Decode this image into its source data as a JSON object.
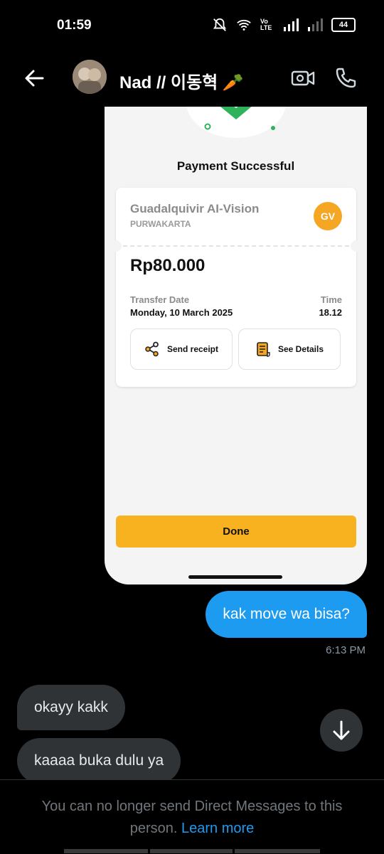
{
  "status_bar": {
    "time": "01:59",
    "network": "Vo LTE",
    "battery": "44"
  },
  "header": {
    "title": "Nad // 이동혁 🥕",
    "icons": [
      "back-arrow-icon",
      "video-camera-icon",
      "phone-icon"
    ]
  },
  "receipt": {
    "title": "Payment Successful",
    "merchant_name": "Guadalquivir AI-Vision",
    "merchant_location": "PURWAKARTA",
    "merchant_initials": "GV",
    "amount": "Rp80.000",
    "transfer_date_label": "Transfer Date",
    "transfer_date": "Monday, 10 March 2025",
    "time_label": "Time",
    "time": "18.12",
    "send_receipt_label": "Send receipt",
    "see_details_label": "See Details",
    "done_label": "Done",
    "accent_color": "#f9b21f"
  },
  "messages": {
    "outgoing": {
      "text": "kak move wa bisa?",
      "time": "6:13 PM"
    },
    "incoming": [
      {
        "text": "okayy kakk"
      },
      {
        "text": "kaaaa buka dulu ya"
      }
    ]
  },
  "footer": {
    "notice": "You can no longer send Direct Messages to this person.",
    "link": "Learn more"
  },
  "colors": {
    "bubble_out": "#1d9bf0",
    "bubble_in": "#2f3336",
    "link": "#1d9bf0"
  }
}
